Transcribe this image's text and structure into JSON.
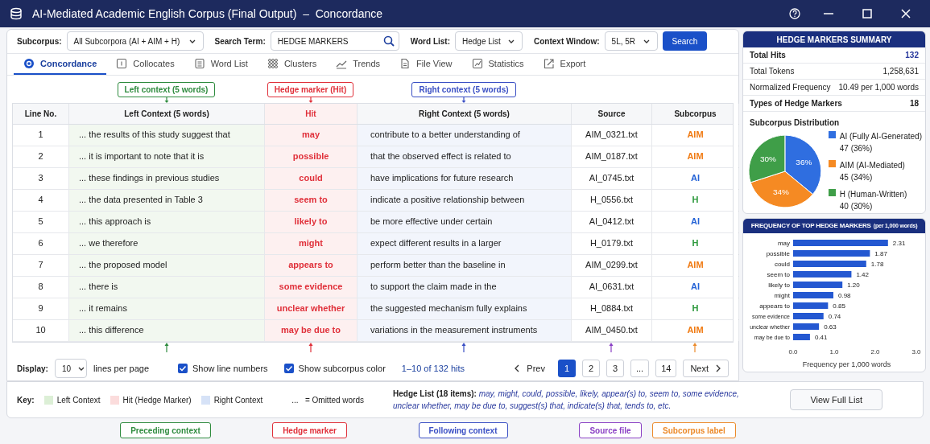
{
  "window": {
    "title": "AI-Mediated Academic English Corpus (Final Output)  –  Concordance"
  },
  "toolbar": {
    "subcorpus": {
      "label": "Subcorpus:",
      "value": "All Subcorpora (AI + AIM + H)"
    },
    "search_term": {
      "label": "Search Term:",
      "value": "HEDGE MARKERS"
    },
    "word_list": {
      "label": "Word List:",
      "value": "Hedge List"
    },
    "context_window": {
      "label": "Context Window:",
      "value": "5L, 5R"
    },
    "search_button": "Search"
  },
  "tabs": [
    {
      "label": "Concordance",
      "kind": "concordance",
      "selected": true
    },
    {
      "label": "Collocates",
      "kind": "collocates",
      "selected": false
    },
    {
      "label": "Word List",
      "kind": "wordlist",
      "selected": false
    },
    {
      "label": "Clusters",
      "kind": "clusters",
      "selected": false
    },
    {
      "label": "Trends",
      "kind": "trends",
      "selected": false
    },
    {
      "label": "File View",
      "kind": "file",
      "selected": false
    },
    {
      "label": "Statistics",
      "kind": "statistics",
      "selected": false
    },
    {
      "label": "Export",
      "kind": "export",
      "selected": false
    }
  ],
  "top_callouts": [
    {
      "label": "Left context (5 words)",
      "color": "#2e8b3e"
    },
    {
      "label": "Hedge marker (Hit)",
      "color": "#e0303a"
    },
    {
      "label": "Right context (5 words)",
      "color": "#3a4fc4"
    }
  ],
  "table": {
    "columns": [
      "Line No.",
      "Left Context (5 words)",
      "Hit",
      "Right Context (5 words)",
      "Source",
      "Subcorpus"
    ],
    "rows": [
      {
        "line": "1",
        "left": "... the results of this study suggest that",
        "hit": "may",
        "right": "contribute to a better understanding of",
        "source": "AIM_0321.txt",
        "subcorpus": "AIM",
        "color": "#f07a12"
      },
      {
        "line": "2",
        "left": "... it is important to note that it is",
        "hit": "possible",
        "right": "that the observed effect is related to",
        "source": "AIM_0187.txt",
        "subcorpus": "AIM",
        "color": "#f07a12"
      },
      {
        "line": "3",
        "left": "... these findings in previous studies",
        "hit": "could",
        "right": "have implications for future research",
        "source": "AI_0745.txt",
        "subcorpus": "AI",
        "color": "#2563d6"
      },
      {
        "line": "4",
        "left": "... the data presented in Table 3",
        "hit": "seem to",
        "right": "indicate a positive relationship between",
        "source": "H_0556.txt",
        "subcorpus": "H",
        "color": "#2e9a3e"
      },
      {
        "line": "5",
        "left": "... this approach is",
        "hit": "likely to",
        "right": "be more effective under certain",
        "source": "AI_0412.txt",
        "subcorpus": "AI",
        "color": "#2563d6"
      },
      {
        "line": "6",
        "left": "... we therefore",
        "hit": "might",
        "right": "expect different results in a larger",
        "source": "H_0179.txt",
        "subcorpus": "H",
        "color": "#2e9a3e"
      },
      {
        "line": "7",
        "left": "... the proposed model",
        "hit": "appears to",
        "right": "perform better than the baseline in",
        "source": "AIM_0299.txt",
        "subcorpus": "AIM",
        "color": "#f07a12"
      },
      {
        "line": "8",
        "left": "... there is",
        "hit": "some evidence",
        "right": "to support the claim made in the",
        "source": "AI_0631.txt",
        "subcorpus": "AI",
        "color": "#2563d6"
      },
      {
        "line": "9",
        "left": "... it remains",
        "hit": "unclear whether",
        "right": "the suggested mechanism fully explains",
        "source": "H_0884.txt",
        "subcorpus": "H",
        "color": "#2e9a3e"
      },
      {
        "line": "10",
        "left": "... this difference",
        "hit": "may be due to",
        "right": "variations in the measurement instruments",
        "source": "AIM_0450.txt",
        "subcorpus": "AIM",
        "color": "#f07a12"
      }
    ]
  },
  "footer": {
    "display": {
      "label": "Display:",
      "value": "10",
      "suffix": "lines per page"
    },
    "checkboxes": [
      {
        "label": "Show line numbers",
        "checked": true
      },
      {
        "label": "Show subcorpus color",
        "checked": true
      }
    ],
    "hits": "1–10 of 132 hits",
    "pagination": {
      "prev": "Prev",
      "pages": [
        {
          "label": "1",
          "selected": true
        },
        {
          "label": "2",
          "selected": false
        },
        {
          "label": "3",
          "selected": false
        },
        {
          "label": "...",
          "selected": false
        },
        {
          "label": "14",
          "selected": false
        }
      ],
      "next": "Next"
    }
  },
  "key": {
    "label": "Key:",
    "items": [
      {
        "label": "Left Context",
        "color": "#dcefd6"
      },
      {
        "label": "Hit (Hedge Marker)",
        "color": "#fbdcdc"
      },
      {
        "label": "Right Context",
        "color": "#d6e2f7"
      }
    ],
    "omitted": "...   = Omitted words"
  },
  "hedge_list": "**Hedge List (18 items):**  *may, might, could, possible, likely, appear(s) to, seem to, some evidence, unclear whether, may be due to, suggest(s) that, indicate(s) that, tends to, etc.*",
  "view_full_list": "View Full List",
  "bottom_callouts": [
    {
      "label": "Preceding context",
      "color": "#2e8b3e"
    },
    {
      "label": "Hedge marker",
      "color": "#e0303a"
    },
    {
      "label": "Following context",
      "color": "#3a4fc4"
    },
    {
      "label": "Source file",
      "color": "#8a3fc4"
    },
    {
      "label": "Subcorpus label",
      "color": "#ec8a2a"
    }
  ],
  "summary": {
    "title": "HEDGE MARKERS SUMMARY",
    "rows": [
      {
        "label": "Total Hits",
        "value": "132",
        "emphasis": true
      },
      {
        "label": "Total Tokens",
        "value": "1,258,631",
        "emphasis": false
      },
      {
        "label": "Normalized Frequency",
        "value": "10.49 per 1,000 words",
        "emphasis": false
      },
      {
        "label": "Types of Hedge Markers",
        "value": "18",
        "emphasis": true
      }
    ],
    "distribution_title": "Subcorpus Distribution",
    "chart_data": {
      "type": "pie",
      "categories": [
        "AI (Fully AI-Generated)",
        "AIM (AI-Mediated)",
        "H (Human-Written)"
      ],
      "series": [
        {
          "colors": [
            "#2f6ee0",
            "#f58a23",
            "#3f9e48"
          ],
          "values": [
            36,
            34,
            30
          ]
        }
      ],
      "value_labels": [
        "36%",
        "34%",
        "30%"
      ]
    },
    "legend": [
      {
        "count": "47 (36%)"
      },
      {
        "count": "45 (34%)"
      },
      {
        "count": "40 (30%)"
      }
    ]
  },
  "frequency": {
    "title": "FREQUENCY OF TOP HEDGE MARKERS",
    "title_note": "(per 1,000 words)",
    "chart_data": {
      "type": "bar",
      "orientation": "horizontal",
      "xlabel": "Frequency per 1,000 words",
      "categories": [
        "may",
        "possible",
        "could",
        "seem to",
        "likely to",
        "might",
        "appears to",
        "some evidence",
        "unclear whether",
        "may be due to"
      ],
      "series": [
        {
          "color": "#2458d1",
          "values": [
            2.31,
            1.87,
            1.78,
            1.42,
            1.2,
            0.98,
            0.85,
            0.74,
            0.63,
            0.41
          ]
        }
      ],
      "xlim": [
        0,
        3
      ],
      "xticks": [
        {
          "value": 0,
          "label": "0.0"
        },
        {
          "value": 1,
          "label": "1.0"
        },
        {
          "value": 2,
          "label": "2.0"
        },
        {
          "value": 3,
          "label": "3.0"
        }
      ],
      "value_labels": [
        "2.31",
        "1.87",
        "1.78",
        "1.42",
        "1.20",
        "0.98",
        "0.85",
        "0.74",
        "0.63",
        "0.41"
      ]
    }
  }
}
